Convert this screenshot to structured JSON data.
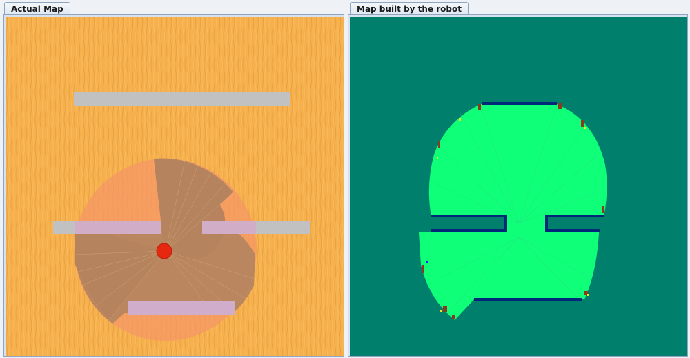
{
  "tabs": {
    "left": "Actual Map",
    "right": "Map built by the robot"
  },
  "colors": {
    "floor": "#f6b14e",
    "floor_stripe": "#e49a3c",
    "wall": "#c1c1c1",
    "wall_overlay": "#d4a9c8",
    "sensor_cone": "#f59668",
    "scanned_area": "#b48462",
    "robot": "#e62810",
    "unknown": "#00806c",
    "free": "#0fff78",
    "obstacle_edge": "#002878",
    "noise": "#8a3a1e"
  },
  "icons": {
    "robot": "red-circle"
  }
}
